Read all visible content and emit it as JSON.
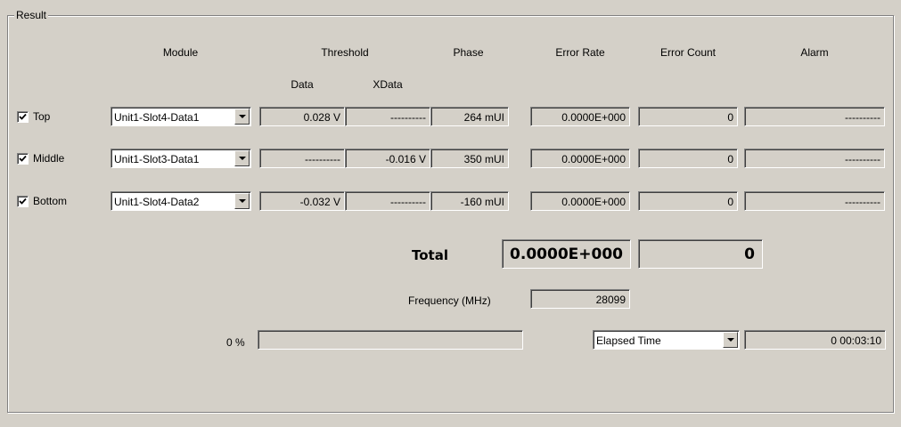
{
  "group": {
    "title": "Result"
  },
  "headers": {
    "module": "Module",
    "threshold": "Threshold",
    "phase": "Phase",
    "error_rate": "Error Rate",
    "error_count": "Error Count",
    "alarm": "Alarm",
    "data": "Data",
    "xdata": "XData"
  },
  "rows": [
    {
      "checked": true,
      "label": "Top",
      "module": "Unit1-Slot4-Data1",
      "data": "0.028 V",
      "xdata": "----------",
      "phase": "264 mUI",
      "error_rate": "0.0000E+000",
      "error_count": "0",
      "alarm": "----------"
    },
    {
      "checked": true,
      "label": "Middle",
      "module": "Unit1-Slot3-Data1",
      "data": "----------",
      "xdata": "-0.016 V",
      "phase": "350 mUI",
      "error_rate": "0.0000E+000",
      "error_count": "0",
      "alarm": "----------"
    },
    {
      "checked": true,
      "label": "Bottom",
      "module": "Unit1-Slot4-Data2",
      "data": "-0.032 V",
      "xdata": "----------",
      "phase": "-160 mUI",
      "error_rate": "0.0000E+000",
      "error_count": "0",
      "alarm": "----------"
    }
  ],
  "total": {
    "label": "Total",
    "error_rate": "0.0000E+000",
    "error_count": "0"
  },
  "frequency": {
    "label": "Frequency (MHz)",
    "value": "28099"
  },
  "progress": {
    "label": "0 %",
    "fraction": 0.0
  },
  "time": {
    "mode": "Elapsed Time",
    "value": "0 00:03:10"
  }
}
